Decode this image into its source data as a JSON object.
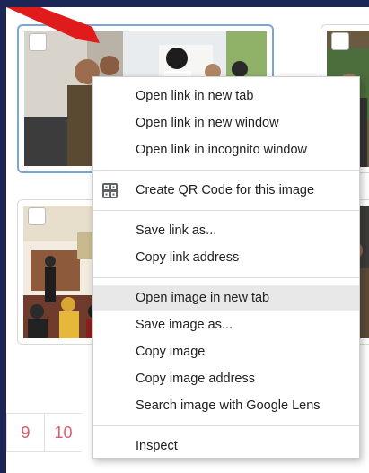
{
  "pagination": {
    "pages": [
      "9",
      "10"
    ]
  },
  "context_menu": {
    "groups": [
      [
        {
          "label": "Open link in new tab"
        },
        {
          "label": "Open link in new window"
        },
        {
          "label": "Open link in incognito window"
        }
      ],
      [
        {
          "label": "Create QR Code for this image",
          "icon": "qr-code-icon"
        }
      ],
      [
        {
          "label": "Save link as..."
        },
        {
          "label": "Copy link address"
        }
      ],
      [
        {
          "label": "Open image in new tab",
          "highlighted": true
        },
        {
          "label": "Save image as..."
        },
        {
          "label": "Copy image"
        },
        {
          "label": "Copy image address"
        },
        {
          "label": "Search image with Google Lens"
        }
      ],
      [
        {
          "label": "Inspect"
        }
      ]
    ]
  },
  "colors": {
    "page_background": "#1b2556",
    "pagination_text": "#e05a72",
    "menu_highlight": "#e8e8e8",
    "selected_border": "#7aa5d8"
  }
}
